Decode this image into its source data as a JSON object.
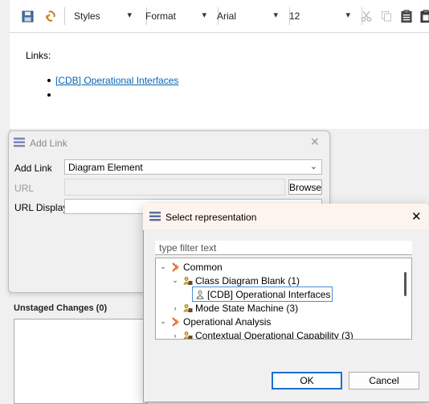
{
  "toolbar": {
    "styles_label": "Styles",
    "format_label": "Format",
    "font_value": "Arial",
    "size_value": "12"
  },
  "editor": {
    "links_label": "Links:",
    "link_items": [
      "[CDB] Operational Interfaces",
      ""
    ]
  },
  "unstaged": {
    "title": "Unstaged Changes (0)"
  },
  "add_link_dialog": {
    "title": "Add Link",
    "add_link_label": "Add Link",
    "add_link_value": "Diagram Element",
    "url_label": "URL",
    "browse_label": "Browse",
    "url_display_label": "URL Display"
  },
  "select_rep_dialog": {
    "title": "Select representation",
    "filter_placeholder": "type filter text",
    "tree": [
      {
        "label": "Common",
        "level": 0,
        "expanded": true,
        "icon": "capella-arrow-icon"
      },
      {
        "label": "Class Diagram Blank (1)",
        "level": 1,
        "expanded": true,
        "icon": "diagram-folder-icon"
      },
      {
        "label": "[CDB] Operational Interfaces",
        "level": 2,
        "selected": true,
        "icon": "diagram-icon"
      },
      {
        "label": "Mode State Machine (3)",
        "level": 1,
        "expanded": false,
        "icon": "diagram-folder-icon"
      },
      {
        "label": "Operational Analysis",
        "level": 0,
        "expanded": true,
        "icon": "capella-arrow-icon"
      },
      {
        "label": "Contextual Operational Capability (3)",
        "level": 1,
        "expanded": false,
        "icon": "diagram-folder-icon"
      }
    ],
    "ok_label": "OK",
    "cancel_label": "Cancel"
  },
  "colors": {
    "link": "#0b64b5",
    "focus": "#1a6fd1",
    "capella_orange": "#e0622a"
  }
}
